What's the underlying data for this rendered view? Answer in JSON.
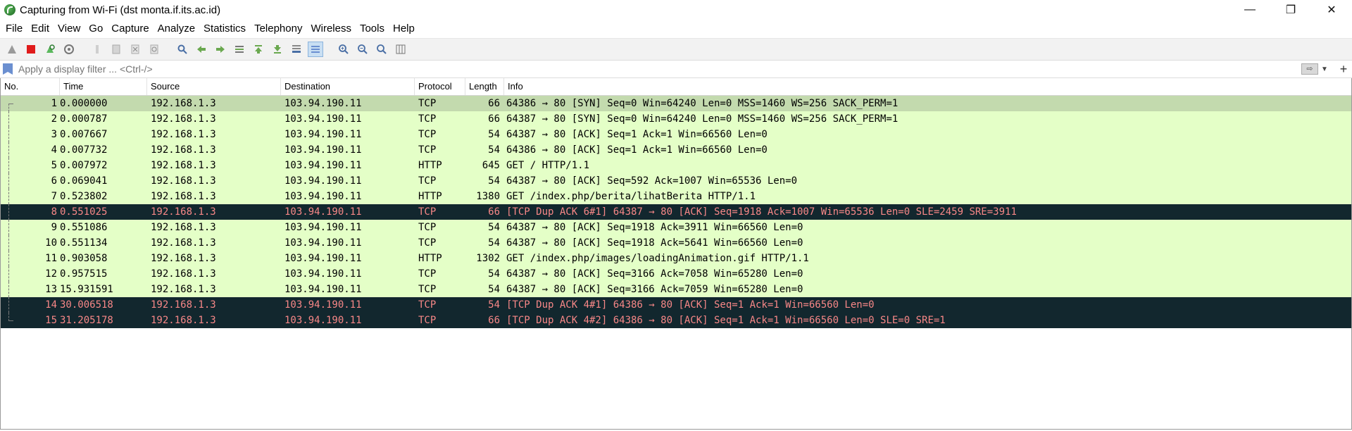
{
  "window": {
    "title": "Capturing from Wi-Fi (dst monta.if.its.ac.id)",
    "controls": {
      "minimize": "—",
      "restore": "❐",
      "close": "✕"
    }
  },
  "menu": [
    "File",
    "Edit",
    "View",
    "Go",
    "Capture",
    "Analyze",
    "Statistics",
    "Telephony",
    "Wireless",
    "Tools",
    "Help"
  ],
  "filter": {
    "placeholder": "Apply a display filter ... <Ctrl-/>",
    "value": ""
  },
  "columns": [
    "No.",
    "Time",
    "Source",
    "Destination",
    "Protocol",
    "Length",
    "Info"
  ],
  "packets": [
    {
      "no": "1",
      "time": "0.000000",
      "src": "192.168.1.3",
      "dst": "103.94.190.11",
      "proto": "TCP",
      "len": "66",
      "info": "64386 → 80 [SYN] Seq=0 Win=64240 Len=0 MSS=1460 WS=256 SACK_PERM=1",
      "style": "sel"
    },
    {
      "no": "2",
      "time": "0.000787",
      "src": "192.168.1.3",
      "dst": "103.94.190.11",
      "proto": "TCP",
      "len": "66",
      "info": "64387 → 80 [SYN] Seq=0 Win=64240 Len=0 MSS=1460 WS=256 SACK_PERM=1",
      "style": "normal"
    },
    {
      "no": "3",
      "time": "0.007667",
      "src": "192.168.1.3",
      "dst": "103.94.190.11",
      "proto": "TCP",
      "len": "54",
      "info": "64387 → 80 [ACK] Seq=1 Ack=1 Win=66560 Len=0",
      "style": "normal"
    },
    {
      "no": "4",
      "time": "0.007732",
      "src": "192.168.1.3",
      "dst": "103.94.190.11",
      "proto": "TCP",
      "len": "54",
      "info": "64386 → 80 [ACK] Seq=1 Ack=1 Win=66560 Len=0",
      "style": "normal"
    },
    {
      "no": "5",
      "time": "0.007972",
      "src": "192.168.1.3",
      "dst": "103.94.190.11",
      "proto": "HTTP",
      "len": "645",
      "info": "GET / HTTP/1.1",
      "style": "normal"
    },
    {
      "no": "6",
      "time": "0.069041",
      "src": "192.168.1.3",
      "dst": "103.94.190.11",
      "proto": "TCP",
      "len": "54",
      "info": "64387 → 80 [ACK] Seq=592 Ack=1007 Win=65536 Len=0",
      "style": "normal"
    },
    {
      "no": "7",
      "time": "0.523802",
      "src": "192.168.1.3",
      "dst": "103.94.190.11",
      "proto": "HTTP",
      "len": "1380",
      "info": "GET /index.php/berita/lihatBerita HTTP/1.1",
      "style": "normal"
    },
    {
      "no": "8",
      "time": "0.551025",
      "src": "192.168.1.3",
      "dst": "103.94.190.11",
      "proto": "TCP",
      "len": "66",
      "info": "[TCP Dup ACK 6#1] 64387 → 80 [ACK] Seq=1918 Ack=1007 Win=65536 Len=0 SLE=2459 SRE=3911",
      "style": "bad"
    },
    {
      "no": "9",
      "time": "0.551086",
      "src": "192.168.1.3",
      "dst": "103.94.190.11",
      "proto": "TCP",
      "len": "54",
      "info": "64387 → 80 [ACK] Seq=1918 Ack=3911 Win=66560 Len=0",
      "style": "normal"
    },
    {
      "no": "10",
      "time": "0.551134",
      "src": "192.168.1.3",
      "dst": "103.94.190.11",
      "proto": "TCP",
      "len": "54",
      "info": "64387 → 80 [ACK] Seq=1918 Ack=5641 Win=66560 Len=0",
      "style": "normal"
    },
    {
      "no": "11",
      "time": "0.903058",
      "src": "192.168.1.3",
      "dst": "103.94.190.11",
      "proto": "HTTP",
      "len": "1302",
      "info": "GET /index.php/images/loadingAnimation.gif HTTP/1.1",
      "style": "normal"
    },
    {
      "no": "12",
      "time": "0.957515",
      "src": "192.168.1.3",
      "dst": "103.94.190.11",
      "proto": "TCP",
      "len": "54",
      "info": "64387 → 80 [ACK] Seq=3166 Ack=7058 Win=65280 Len=0",
      "style": "normal"
    },
    {
      "no": "13",
      "time": "15.931591",
      "src": "192.168.1.3",
      "dst": "103.94.190.11",
      "proto": "TCP",
      "len": "54",
      "info": "64387 → 80 [ACK] Seq=3166 Ack=7059 Win=65280 Len=0",
      "style": "normal"
    },
    {
      "no": "14",
      "time": "30.006518",
      "src": "192.168.1.3",
      "dst": "103.94.190.11",
      "proto": "TCP",
      "len": "54",
      "info": "[TCP Dup ACK 4#1] 64386 → 80 [ACK] Seq=1 Ack=1 Win=66560 Len=0",
      "style": "bad"
    },
    {
      "no": "15",
      "time": "31.205178",
      "src": "192.168.1.3",
      "dst": "103.94.190.11",
      "proto": "TCP",
      "len": "66",
      "info": "[TCP Dup ACK 4#2] 64386 → 80 [ACK] Seq=1 Ack=1 Win=66560 Len=0 SLE=0 SRE=1",
      "style": "bad"
    }
  ],
  "colors": {
    "selected_row": "#c3daae",
    "tcp_http_row": "#e4ffc7",
    "bad_tcp_row_bg": "#12272e",
    "bad_tcp_row_fg": "#f78787"
  }
}
